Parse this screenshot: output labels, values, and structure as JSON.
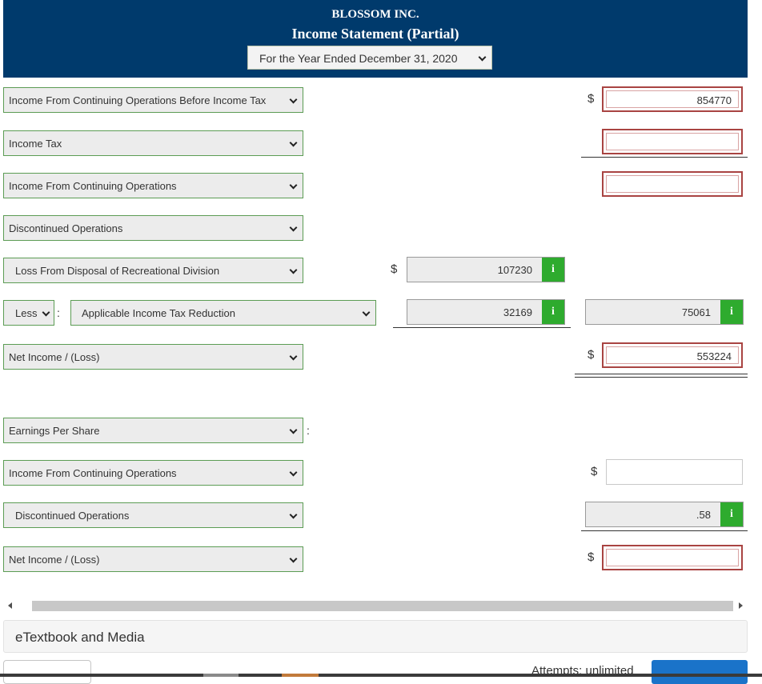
{
  "header": {
    "company": "BLOSSOM INC.",
    "statement": "Income Statement (Partial)",
    "period": "For the Year Ended December 31, 2020"
  },
  "rows": {
    "r1_label": "Income From Continuing Operations Before Income Tax",
    "r1_value": "854770",
    "r2_label": "Income Tax",
    "r3_label": "Income From Continuing Operations",
    "r4_label": "Discontinued Operations",
    "r5_label": "Loss From Disposal of Recreational Division",
    "r5_value": "107230",
    "r6_less": "Less",
    "r6_label": "Applicable Income Tax Reduction",
    "r6_value": "32169",
    "r6_total": "75061",
    "r7_label": "Net Income / (Loss)",
    "r7_value": "553224",
    "eps_label": "Earnings Per Share",
    "eps1_label": "Income From Continuing Operations",
    "eps2_label": "Discontinued Operations",
    "eps2_value": ".58",
    "eps3_label": "Net Income / (Loss)"
  },
  "symbols": {
    "dollar": "$",
    "colon": ":",
    "info": "i"
  },
  "footer": {
    "etextbook": "eTextbook and Media",
    "attempts": "Attempts: unlimited"
  },
  "colors": {
    "header_bg": "#003a6c",
    "select_border": "#5c9c54",
    "error_border": "#a94442",
    "info_green": "#2eab2e"
  }
}
